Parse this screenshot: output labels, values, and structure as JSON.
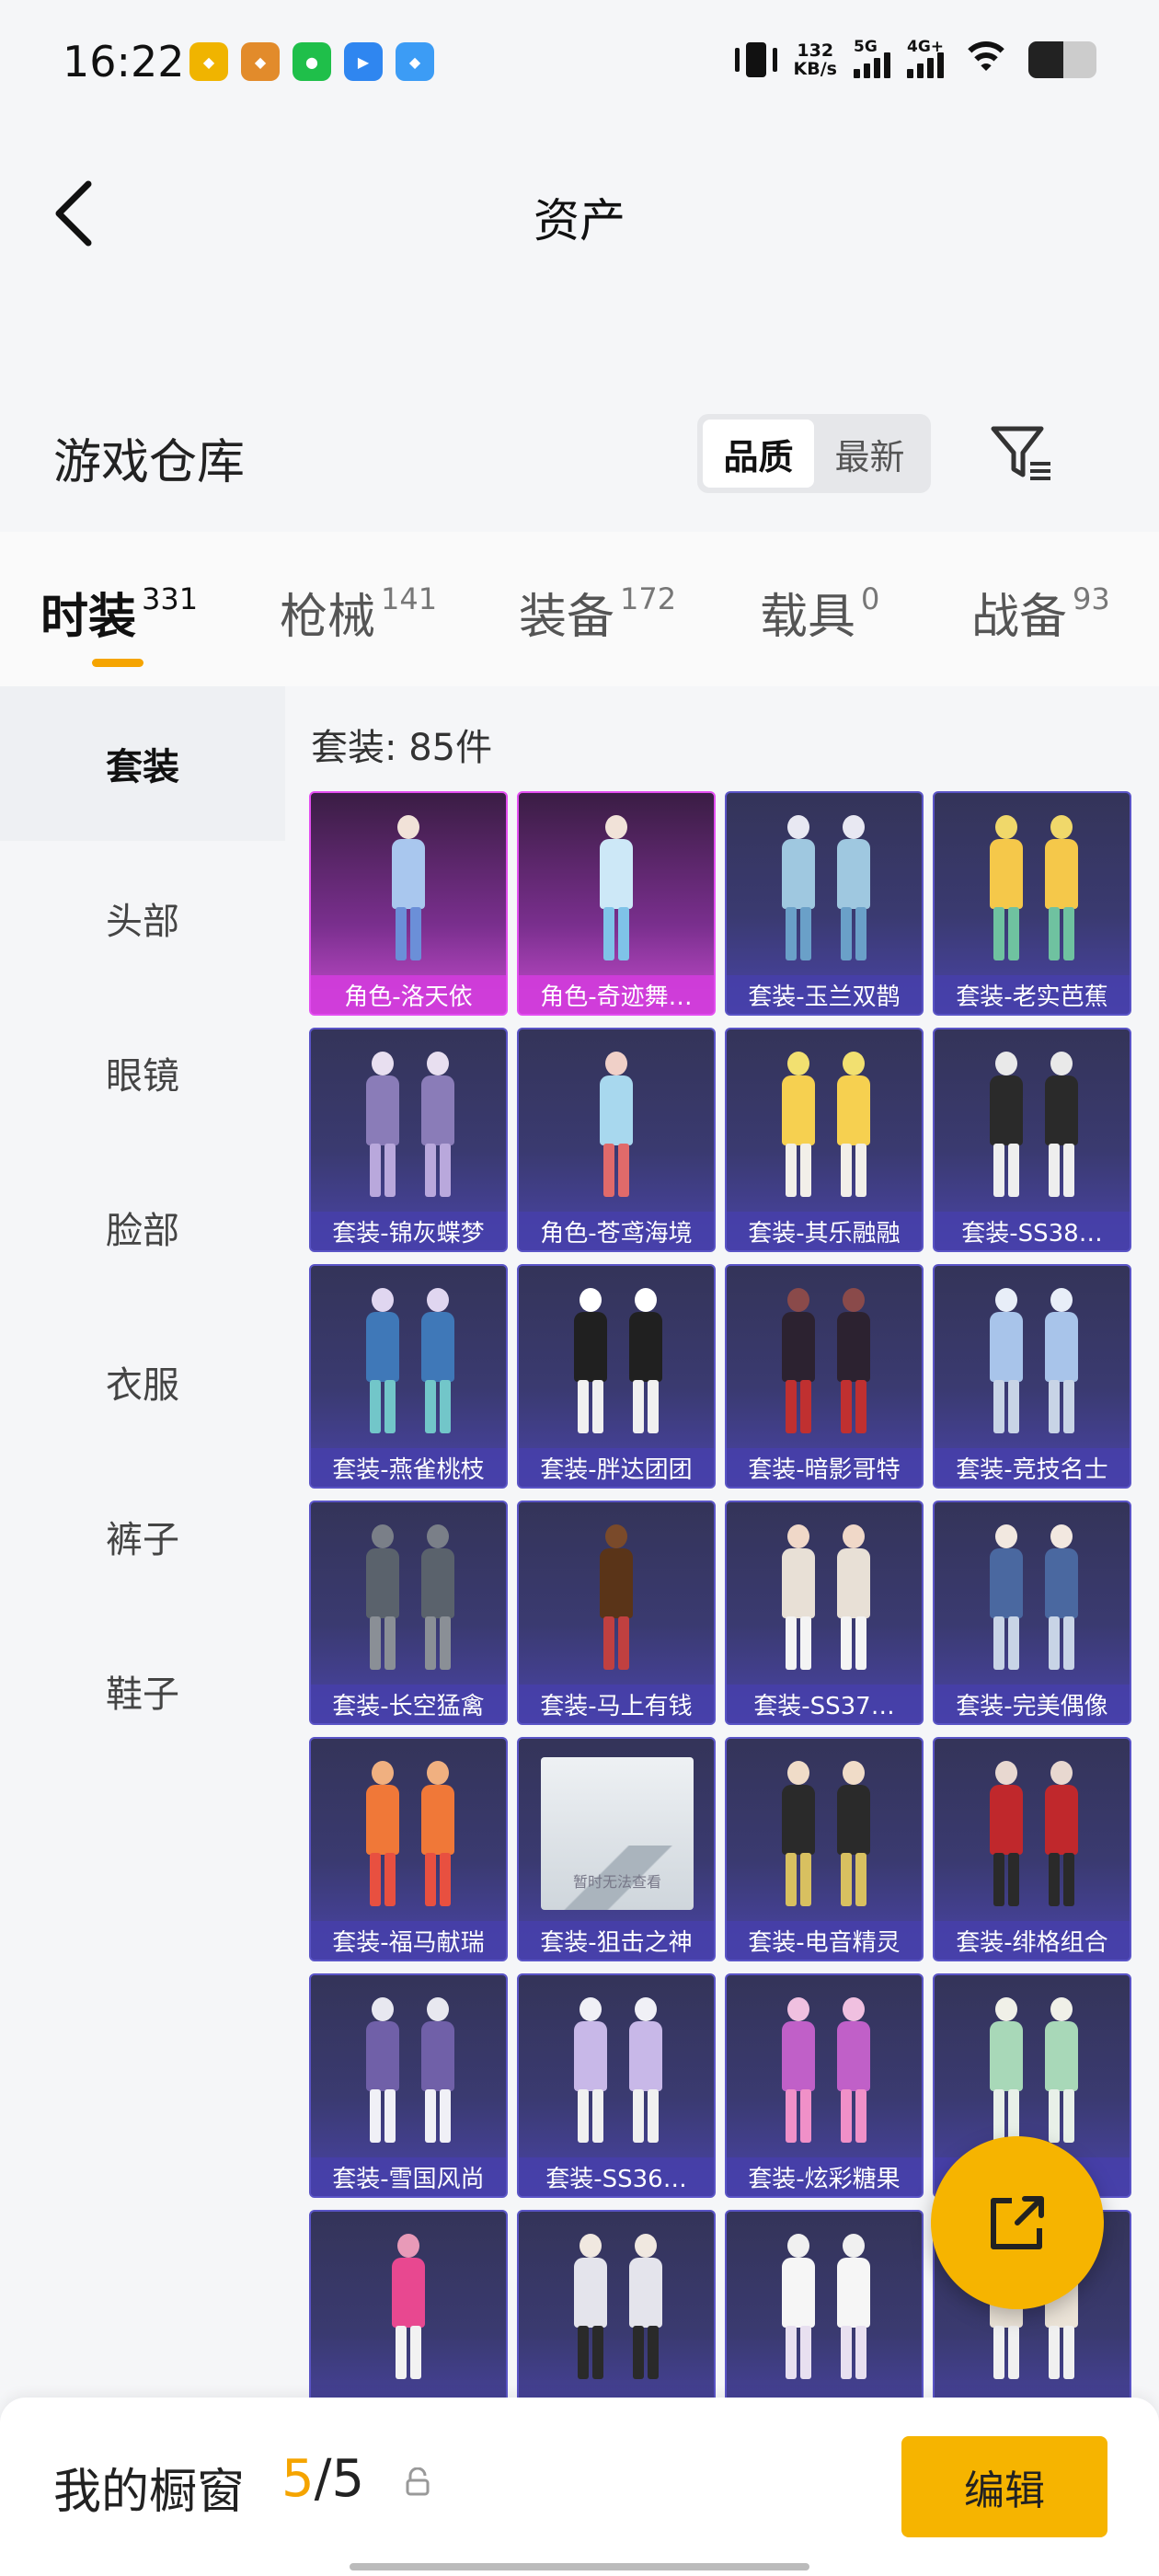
{
  "status_bar": {
    "time": "16:22",
    "net_speed_value": "132",
    "net_speed_unit": "KB/s",
    "signal1_label": "5G",
    "signal2_label": "4G+",
    "battery_percent": 52
  },
  "header": {
    "title": "资产",
    "back_icon": "chevron-left-icon"
  },
  "warehouse": {
    "title": "游戏仓库",
    "sort_options": [
      "品质",
      "最新"
    ],
    "sort_selected": "品质",
    "filter_icon": "filter-icon"
  },
  "tabs": [
    {
      "label": "时装",
      "count": "331"
    },
    {
      "label": "枪械",
      "count": "141"
    },
    {
      "label": "装备",
      "count": "172"
    },
    {
      "label": "载具",
      "count": "0"
    },
    {
      "label": "战备",
      "count": "93"
    }
  ],
  "active_tab": "时装",
  "sidebar": {
    "items": [
      "套装",
      "头部",
      "眼镜",
      "脸部",
      "衣服",
      "裤子",
      "鞋子"
    ],
    "active": "套装"
  },
  "content": {
    "count_label": "套装: 85件",
    "items": [
      {
        "label": "角色-洛天依"
      },
      {
        "label": "角色-奇迹舞…"
      },
      {
        "label": "套装-玉兰双鹊"
      },
      {
        "label": "套装-老实芭蕉"
      },
      {
        "label": "套装-锦灰蝶梦"
      },
      {
        "label": "角色-苍鸢海境"
      },
      {
        "label": "套装-其乐融融"
      },
      {
        "label": "套装-SS38…"
      },
      {
        "label": "套装-燕雀桃枝"
      },
      {
        "label": "套装-胖达团团"
      },
      {
        "label": "套装-暗影哥特"
      },
      {
        "label": "套装-竞技名士"
      },
      {
        "label": "套装-长空猛禽"
      },
      {
        "label": "套装-马上有钱"
      },
      {
        "label": "套装-SS37…"
      },
      {
        "label": "套装-完美偶像"
      },
      {
        "label": "套装-福马献瑞"
      },
      {
        "label": "套装-狙击之神"
      },
      {
        "label": "套装-电音精灵"
      },
      {
        "label": "套装-绯格组合"
      },
      {
        "label": "套装-雪国风尚"
      },
      {
        "label": "套装-SS36…"
      },
      {
        "label": "套装-炫彩糖果"
      },
      {
        "label": "…"
      },
      {
        "label": ""
      },
      {
        "label": ""
      },
      {
        "label": ""
      },
      {
        "label": ""
      }
    ],
    "placeholder_text": "暂时无法查看"
  },
  "fab_icon": "share-external-icon",
  "bottom": {
    "title": "我的橱窗",
    "count_current": "5",
    "count_sep_total": "/5",
    "lock_icon": "lock-icon",
    "edit_label": "编辑"
  }
}
